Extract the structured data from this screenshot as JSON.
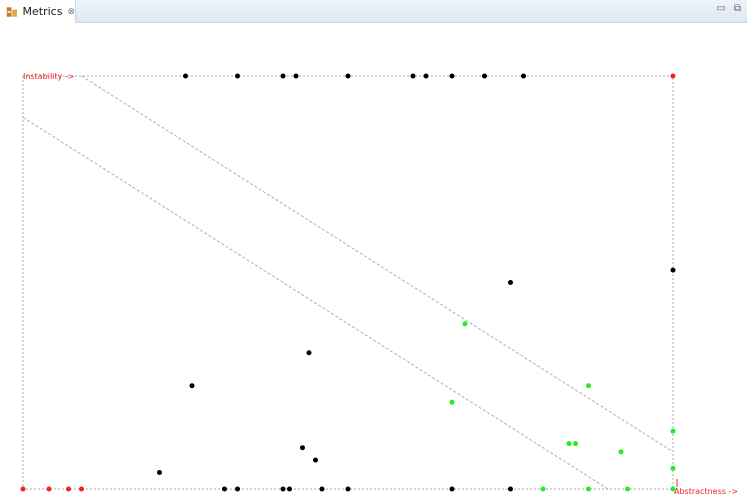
{
  "tab": {
    "title": "Metrics",
    "close_glyph": "⊗",
    "icon": "metrics-view-icon"
  },
  "window_controls": {
    "minimize_glyph": "▭",
    "maximize_glyph": "⧉"
  },
  "chart_data": {
    "type": "scatter",
    "xlabel": "Abstractness ->",
    "ylabel": "Instability ->",
    "xlim": [
      0,
      1
    ],
    "ylim": [
      0,
      1
    ],
    "grid": false,
    "reference_lines": [
      {
        "from": [
          0.0,
          0.9
        ],
        "to": [
          0.9,
          0.0
        ]
      },
      {
        "from": [
          0.09,
          1.0
        ],
        "to": [
          1.0,
          0.09
        ]
      }
    ],
    "colors": {
      "normal": "#000000",
      "good": "#22ee22",
      "bad": "#ee2222",
      "axis": "#ee2222",
      "frame": "#aaaaaa",
      "line": "#b0b0b0"
    },
    "points": [
      {
        "x": 0.25,
        "y": 1.0,
        "c": "normal"
      },
      {
        "x": 0.33,
        "y": 1.0,
        "c": "normal"
      },
      {
        "x": 0.4,
        "y": 1.0,
        "c": "normal"
      },
      {
        "x": 0.42,
        "y": 1.0,
        "c": "normal"
      },
      {
        "x": 0.5,
        "y": 1.0,
        "c": "normal"
      },
      {
        "x": 0.6,
        "y": 1.0,
        "c": "normal"
      },
      {
        "x": 0.62,
        "y": 1.0,
        "c": "normal"
      },
      {
        "x": 0.66,
        "y": 1.0,
        "c": "normal"
      },
      {
        "x": 0.71,
        "y": 1.0,
        "c": "normal"
      },
      {
        "x": 0.77,
        "y": 1.0,
        "c": "normal"
      },
      {
        "x": 1.0,
        "y": 1.0,
        "c": "bad"
      },
      {
        "x": 1.0,
        "y": 0.53,
        "c": "normal"
      },
      {
        "x": 0.75,
        "y": 0.5,
        "c": "normal"
      },
      {
        "x": 0.68,
        "y": 0.4,
        "c": "good"
      },
      {
        "x": 0.44,
        "y": 0.33,
        "c": "normal"
      },
      {
        "x": 0.26,
        "y": 0.25,
        "c": "normal"
      },
      {
        "x": 0.66,
        "y": 0.21,
        "c": "good"
      },
      {
        "x": 0.87,
        "y": 0.25,
        "c": "good"
      },
      {
        "x": 1.0,
        "y": 0.14,
        "c": "good"
      },
      {
        "x": 0.84,
        "y": 0.11,
        "c": "good"
      },
      {
        "x": 0.85,
        "y": 0.11,
        "c": "good"
      },
      {
        "x": 0.92,
        "y": 0.09,
        "c": "good"
      },
      {
        "x": 0.43,
        "y": 0.1,
        "c": "normal"
      },
      {
        "x": 0.45,
        "y": 0.07,
        "c": "normal"
      },
      {
        "x": 1.0,
        "y": 0.05,
        "c": "good"
      },
      {
        "x": 0.21,
        "y": 0.04,
        "c": "normal"
      },
      {
        "x": 0.0,
        "y": 0.0,
        "c": "bad"
      },
      {
        "x": 0.04,
        "y": 0.0,
        "c": "bad"
      },
      {
        "x": 0.07,
        "y": 0.0,
        "c": "bad"
      },
      {
        "x": 0.09,
        "y": 0.0,
        "c": "bad"
      },
      {
        "x": 0.31,
        "y": 0.0,
        "c": "normal"
      },
      {
        "x": 0.33,
        "y": 0.0,
        "c": "normal"
      },
      {
        "x": 0.4,
        "y": 0.0,
        "c": "normal"
      },
      {
        "x": 0.41,
        "y": 0.0,
        "c": "normal"
      },
      {
        "x": 0.46,
        "y": 0.0,
        "c": "normal"
      },
      {
        "x": 0.5,
        "y": 0.0,
        "c": "normal"
      },
      {
        "x": 0.66,
        "y": 0.0,
        "c": "normal"
      },
      {
        "x": 0.75,
        "y": 0.0,
        "c": "normal"
      },
      {
        "x": 0.8,
        "y": 0.0,
        "c": "good"
      },
      {
        "x": 0.87,
        "y": 0.0,
        "c": "good"
      },
      {
        "x": 0.93,
        "y": 0.0,
        "c": "good"
      },
      {
        "x": 1.0,
        "y": 0.0,
        "c": "good"
      }
    ]
  }
}
